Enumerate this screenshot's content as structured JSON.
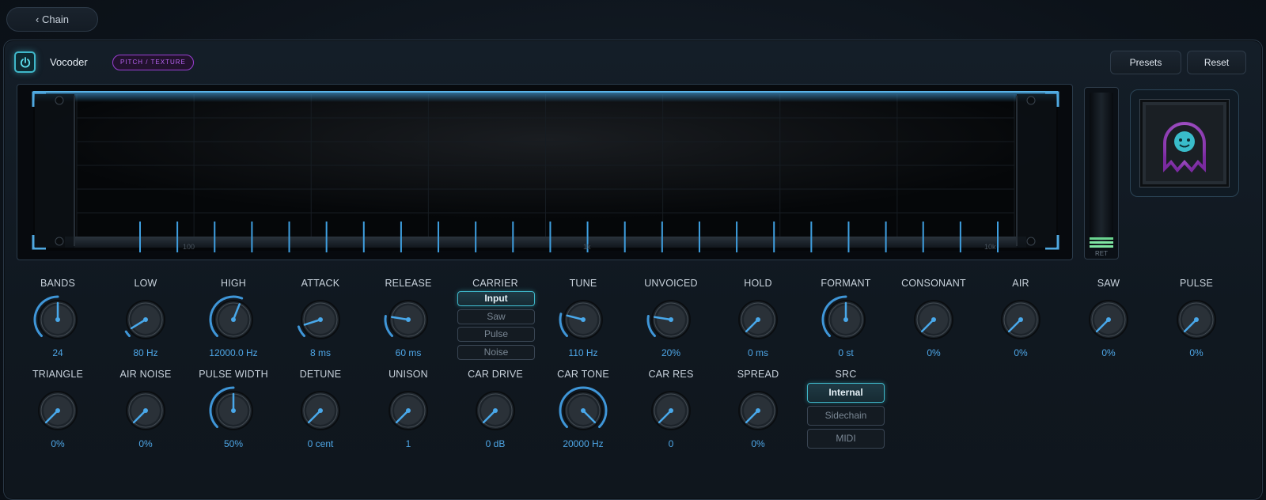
{
  "nav": {
    "back_label": "‹ Chain"
  },
  "header": {
    "title": "Vocoder",
    "tag": "PITCH / TEXTURE",
    "presets_label": "Presets",
    "reset_label": "Reset"
  },
  "display": {
    "band_count": 24,
    "axis_labels": [
      "100",
      "1k",
      "10k"
    ]
  },
  "meter": {
    "label": "RET",
    "level": 0.06
  },
  "carrier": {
    "label": "CARRIER",
    "options": [
      "Input",
      "Saw",
      "Pulse",
      "Noise"
    ],
    "selected": "Input"
  },
  "src": {
    "label": "SRC",
    "options": [
      "Internal",
      "Sidechain",
      "MIDI"
    ],
    "selected": "Internal"
  },
  "knobs_row1": [
    {
      "label": "BANDS",
      "value": "24",
      "fraction": 0.5
    },
    {
      "label": "LOW",
      "value": "80 Hz",
      "fraction": 0.05
    },
    {
      "label": "HIGH",
      "value": "12000.0 Hz",
      "fraction": 0.58
    },
    {
      "label": "ATTACK",
      "value": "8 ms",
      "fraction": 0.1
    },
    {
      "label": "RELEASE",
      "value": "60 ms",
      "fraction": 0.2
    },
    {
      "label": "TUNE",
      "value": "110 Hz",
      "fraction": 0.22
    },
    {
      "label": "UNVOICED",
      "value": "20%",
      "fraction": 0.2
    },
    {
      "label": "HOLD",
      "value": "0 ms",
      "fraction": 0.0
    },
    {
      "label": "FORMANT",
      "value": "0 st",
      "fraction": 0.5
    },
    {
      "label": "CONSONANT",
      "value": "0%",
      "fraction": 0.0
    },
    {
      "label": "AIR",
      "value": "0%",
      "fraction": 0.0
    },
    {
      "label": "SAW",
      "value": "0%",
      "fraction": 0.0
    },
    {
      "label": "PULSE",
      "value": "0%",
      "fraction": 0.0
    }
  ],
  "knobs_row2": [
    {
      "label": "TRIANGLE",
      "value": "0%",
      "fraction": 0.0
    },
    {
      "label": "AIR NOISE",
      "value": "0%",
      "fraction": 0.0
    },
    {
      "label": "PULSE WIDTH",
      "value": "50%",
      "fraction": 0.5
    },
    {
      "label": "DETUNE",
      "value": "0 cent",
      "fraction": 0.0
    },
    {
      "label": "UNISON",
      "value": "1",
      "fraction": 0.0
    },
    {
      "label": "CAR DRIVE",
      "value": "0 dB",
      "fraction": 0.0
    },
    {
      "label": "CAR TONE",
      "value": "20000 Hz",
      "fraction": 1.0
    },
    {
      "label": "CAR RES",
      "value": "0",
      "fraction": 0.0
    },
    {
      "label": "SPREAD",
      "value": "0%",
      "fraction": 0.0
    }
  ],
  "colors": {
    "accent": "#4ea6e6",
    "active": "#3fb7c9",
    "tag": "#b562f0"
  }
}
